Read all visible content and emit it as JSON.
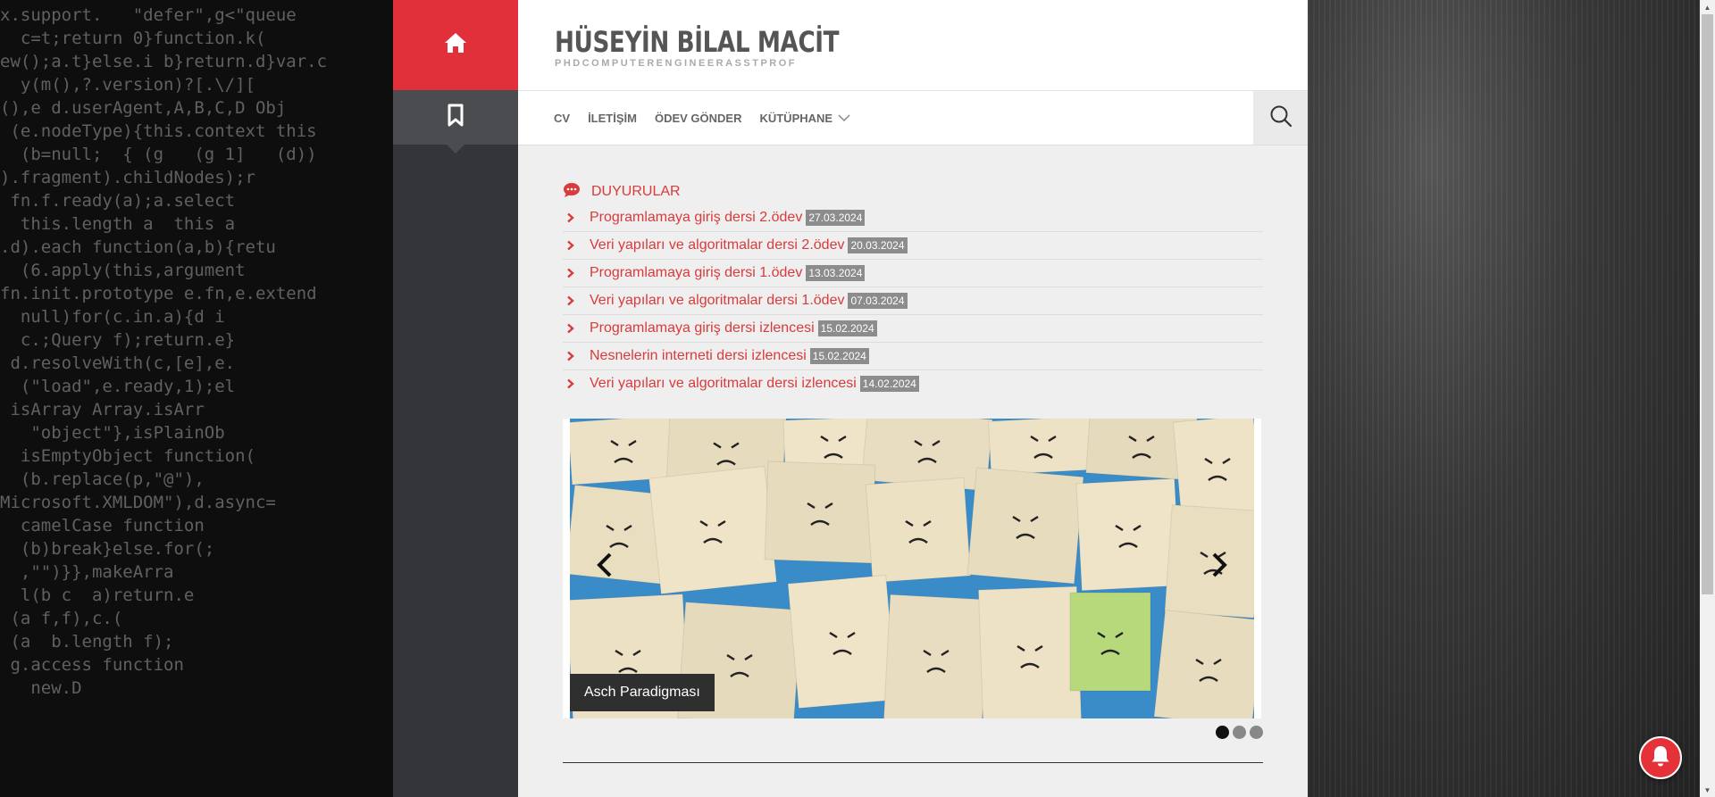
{
  "header": {
    "site_title": "HÜSEYİN BİLAL MACİT",
    "tagline": "PHDCOMPUTERENGINEERASSTPROF"
  },
  "nav": {
    "items": [
      {
        "label": "CV"
      },
      {
        "label": "İLETİŞİM"
      },
      {
        "label": "ÖDEV GÖNDER"
      },
      {
        "label": "KÜTÜPHANE"
      }
    ]
  },
  "announcements": {
    "heading": "DUYURULAR",
    "items": [
      {
        "title": "Programlamaya giriş dersi 2.ödev",
        "date": "27.03.2024"
      },
      {
        "title": "Veri yapıları ve algoritmalar dersi 2.ödev",
        "date": "20.03.2024"
      },
      {
        "title": "Programlamaya giriş dersi 1.ödev",
        "date": "13.03.2024"
      },
      {
        "title": "Veri yapıları ve algoritmalar dersi 1.ödev",
        "date": "07.03.2024"
      },
      {
        "title": "Programlamaya giriş dersi izlencesi",
        "date": "15.02.2024"
      },
      {
        "title": "Nesnelerin interneti dersi izlencesi",
        "date": "15.02.2024"
      },
      {
        "title": "Veri yapıları ve algoritmalar dersi izlencesi",
        "date": "14.02.2024"
      }
    ]
  },
  "slider": {
    "caption": "Asch Paradigması",
    "slide_count": 3,
    "active_index": 0
  },
  "background_code": [
    "x.support.   \"defer\",g<\"queue",
    "  c=t;return 0}function.k(",
    "ew();a.t}else.i b}return.d}var.c",
    "  y(m(),?.version)?[.\\/][",
    "(),e d.userAgent,A,B,C,D Obj",
    " (e.nodeType){this.context this",
    "  (b=null;  { (g   (g 1]   (d))",
    ").fragment).childNodes);r",
    " fn.f.ready(a);a.select",
    "  this.length a  this a",
    ".d).each function(a,b){retu",
    "  (6.apply(this,argument",
    "fn.init.prototype e.fn,e.extend",
    "  null)for(c.in.a){d i",
    "  c.;Query f);return.e}",
    " d.resolveWith(c,[e],e.",
    "  (\"load\",e.ready,1);el",
    " isArray Array.isArr",
    "   \"object\"},isPlainOb",
    "  isEmptyObject function(",
    "  (b.replace(p,\"@\"),",
    "Microsoft.XMLDOM\"),d.async=",
    "  camelCase function",
    "  (b)break}else.for(;",
    "  ,\"\")}},makeArra",
    "  l(b c  a)return.e",
    " (a f,f),c.(",
    " (a  b.length f);",
    " g.access function",
    "   new.D"
  ]
}
